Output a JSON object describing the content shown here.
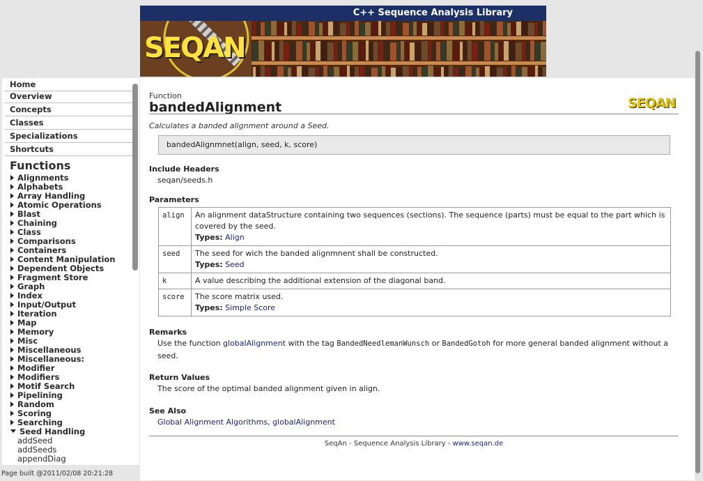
{
  "banner": {
    "title": "C++ Sequence Analysis Library",
    "logo_text": "SEQAN"
  },
  "sidebar": {
    "nav": [
      {
        "label": "Home"
      },
      {
        "label": "Overview"
      },
      {
        "label": "Concepts"
      },
      {
        "label": "Classes"
      },
      {
        "label": "Specializations"
      },
      {
        "label": "Shortcuts"
      }
    ],
    "functions_heading": "Functions",
    "categories": [
      "Alignments",
      "Alphabets",
      "Array Handling",
      "Atomic Operations",
      "Blast",
      "Chaining",
      "Class",
      "Comparisons",
      "Containers",
      "Content Manipulation",
      "Dependent Objects",
      "Fragment Store",
      "Graph",
      "Index",
      "Input/Output",
      "Iteration",
      "Map",
      "Memory",
      "Misc",
      "Miscellaneous",
      "Miscellaneous:",
      "Modifier",
      "Modifiers",
      "Motif Search",
      "Pipelining",
      "Random",
      "Scoring",
      "Searching",
      "Seed Handling"
    ],
    "expanded_items": [
      "addSeed",
      "addSeeds",
      "appendDiag"
    ],
    "page_built": "Page built @2011/02/08 20:21:28"
  },
  "main": {
    "kind": "Function",
    "title": "bandedAlignment",
    "logo_text": "SEQAN",
    "description": "Calculates a banded alignment around a Seed.",
    "signature": "bandedAlignmnet(align, seed, k, score)",
    "include_headers": {
      "heading": "Include Headers",
      "value": "seqan/seeds.h"
    },
    "parameters": {
      "heading": "Parameters",
      "types_label": "Types:",
      "rows": [
        {
          "name": "align",
          "desc": "An alignment dataStructure containing two sequences (sections). The sequence (parts) must be equal to the part which is covered by the seed.",
          "type": "Align"
        },
        {
          "name": "seed",
          "desc": "The seed for wich the banded alignmnent shall be constructed.",
          "type": "Seed"
        },
        {
          "name": "k",
          "desc": "A value describing the additional extension of the diagonal band."
        },
        {
          "name": "score",
          "desc": "The score matrix used.",
          "type": "Simple Score"
        }
      ]
    },
    "remarks": {
      "heading": "Remarks",
      "p1": "Use the function ",
      "link1": "globalAlignment",
      "p2": " with the tag ",
      "tag1": "BandedNeedlemanWunsch",
      "p3": " or ",
      "tag2": "BandedGotoh",
      "p4": " for more general banded alignment without a seed."
    },
    "return_values": {
      "heading": "Return Values",
      "value": "The score of the optimal banded alignment given in align."
    },
    "see_also": {
      "heading": "See Also",
      "link1": "Global Alignment Algorithms",
      "separator": ", ",
      "link2": "globalAlignment"
    },
    "footer": {
      "text": "SeqAn - Sequence Analysis Library - ",
      "link": "www.seqan.de"
    }
  },
  "colors": {
    "banner_strip": "#1c2f66",
    "link": "#1a237e",
    "logo_yellow": "#ffe23a"
  }
}
